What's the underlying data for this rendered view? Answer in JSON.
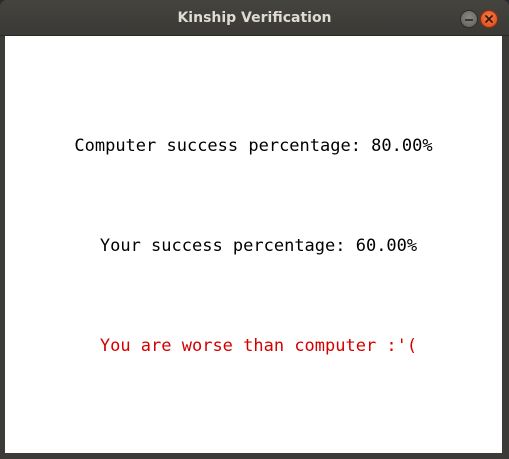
{
  "window": {
    "title": "Kinship Verification"
  },
  "results": {
    "computer_line": "Computer success percentage: 80.00%",
    "user_line": "Your success percentage: 60.00%",
    "verdict_line": "You are worse than computer :'(",
    "computer_percentage": 80.0,
    "user_percentage": 60.0,
    "verdict_color": "#d40000"
  }
}
